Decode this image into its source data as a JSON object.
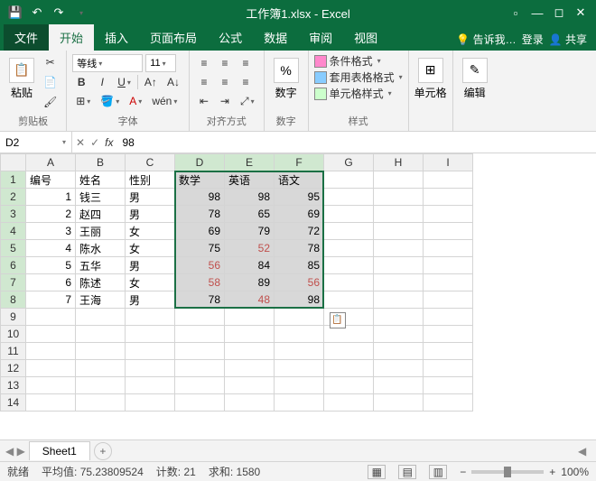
{
  "title": "工作簿1.xlsx - Excel",
  "share": "共享",
  "login": "登录",
  "tellme": "告诉我…",
  "tabs": {
    "file": "文件",
    "home": "开始",
    "insert": "插入",
    "layout": "页面布局",
    "formula": "公式",
    "data": "数据",
    "review": "审阅",
    "view": "视图"
  },
  "ribbon": {
    "clipboard": {
      "label": "剪贴板",
      "paste": "粘贴"
    },
    "font": {
      "label": "字体",
      "name": "等线",
      "size": "11"
    },
    "align": {
      "label": "对齐方式"
    },
    "number": {
      "label": "数字",
      "btn": "数字",
      "percent": "%"
    },
    "styles": {
      "label": "样式",
      "cond": "条件格式",
      "table": "套用表格格式",
      "cell": "单元格样式"
    },
    "cells": {
      "label": "单元格"
    },
    "editing": {
      "label": "编辑"
    }
  },
  "namebox": "D2",
  "formula_value": "98",
  "columns": [
    "A",
    "B",
    "C",
    "D",
    "E",
    "F",
    "G",
    "H",
    "I"
  ],
  "rows": [
    1,
    2,
    3,
    4,
    5,
    6,
    7,
    8,
    9,
    10,
    11,
    12,
    13,
    14
  ],
  "headers": {
    "A": "编号",
    "B": "姓名",
    "C": "性别",
    "D": "数学",
    "E": "英语",
    "F": "语文"
  },
  "data": [
    {
      "A": 1,
      "B": "钱三",
      "C": "男",
      "D": 98,
      "E": 98,
      "F": 95
    },
    {
      "A": 2,
      "B": "赵四",
      "C": "男",
      "D": 78,
      "E": 65,
      "F": 69
    },
    {
      "A": 3,
      "B": "王丽",
      "C": "女",
      "D": 69,
      "E": 79,
      "F": 72
    },
    {
      "A": 4,
      "B": "陈水",
      "C": "女",
      "D": 75,
      "E": 52,
      "F": 78
    },
    {
      "A": 5,
      "B": "五华",
      "C": "男",
      "D": 56,
      "E": 84,
      "F": 85
    },
    {
      "A": 6,
      "B": "陈述",
      "C": "女",
      "D": 58,
      "E": 89,
      "F": 56
    },
    {
      "A": 7,
      "B": "王海",
      "C": "男",
      "D": 78,
      "E": 48,
      "F": 98
    }
  ],
  "sheet": "Sheet1",
  "status": {
    "ready": "就绪",
    "avg_l": "平均值:",
    "avg": "75.23809524",
    "cnt_l": "计数:",
    "cnt": "21",
    "sum_l": "求和:",
    "sum": "1580",
    "zoom": "100%"
  },
  "lowcolor": "#c0504d",
  "selection": {
    "startCol": "D",
    "endCol": "F",
    "startRow": 1,
    "endRow": 8
  }
}
